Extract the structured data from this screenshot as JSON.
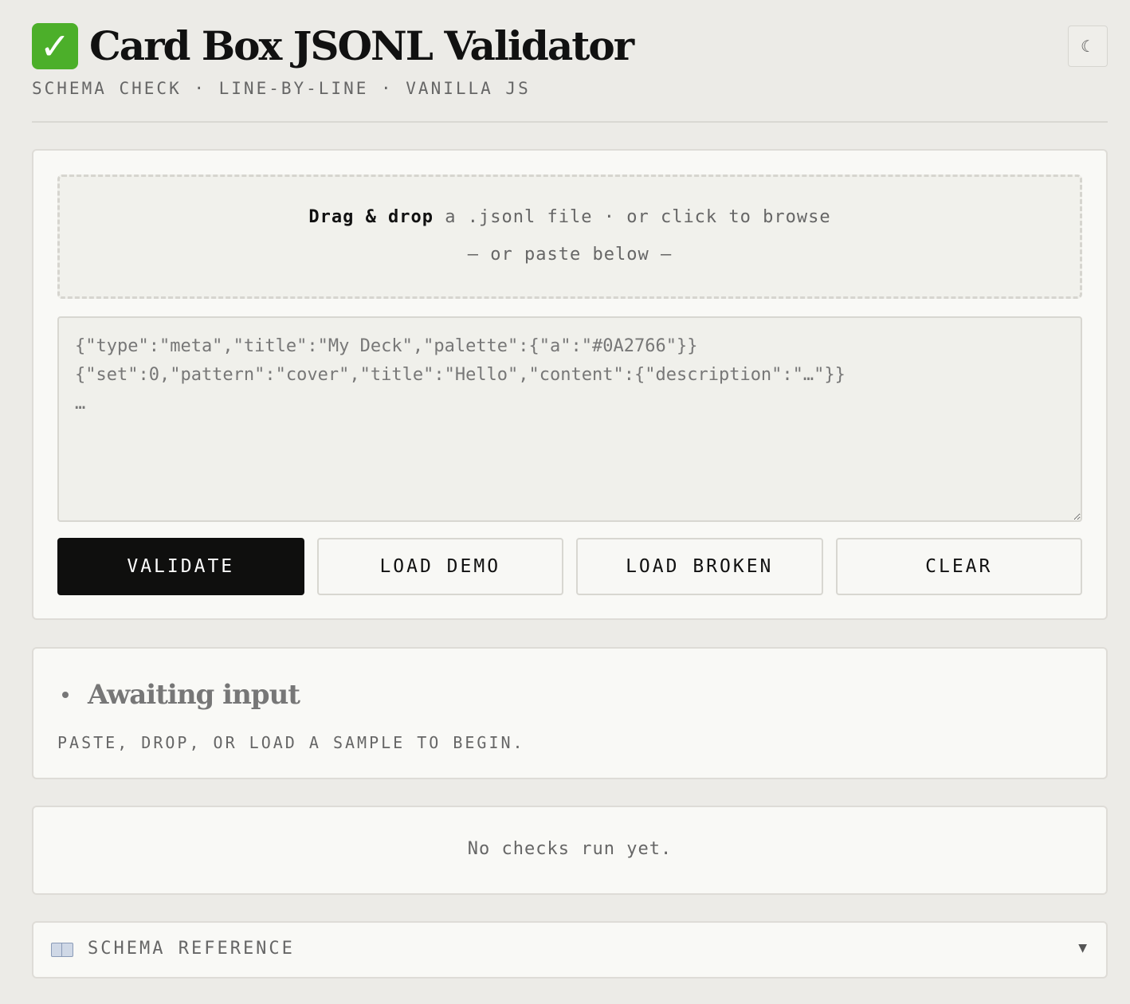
{
  "header": {
    "title": "Card Box JSONL Validator",
    "subtitle": "SCHEMA CHECK · LINE-BY-LINE · VANILLA JS",
    "theme_toggle_glyph": "☾"
  },
  "dropzone": {
    "strong": "Drag & drop",
    "rest": " a .jsonl file · or click to browse",
    "line2": "— or paste below —"
  },
  "input": {
    "placeholder": "{\"type\":\"meta\",\"title\":\"My Deck\",\"palette\":{\"a\":\"#0A2766\"}}\n{\"set\":0,\"pattern\":\"cover\",\"title\":\"Hello\",\"content\":{\"description\":\"…\"}}\n…",
    "value": ""
  },
  "buttons": {
    "validate": "VALIDATE",
    "load_demo": "LOAD DEMO",
    "load_broken": "LOAD BROKEN",
    "clear": "CLEAR"
  },
  "status": {
    "title": "Awaiting input",
    "subtitle": "PASTE, DROP, OR LOAD A SAMPLE TO BEGIN."
  },
  "results": {
    "empty_text": "No checks run yet."
  },
  "schema_reference": {
    "label": "SCHEMA REFERENCE",
    "chevron_glyph": "▼"
  },
  "colors": {
    "background": "#ecebe7",
    "card": "#f9f9f6",
    "primary_button": "#0f0f0e",
    "check_icon": "#4caf2a"
  },
  "icons": [
    "check-mark-icon",
    "moon-icon",
    "book-icon",
    "chevron-down-icon"
  ]
}
